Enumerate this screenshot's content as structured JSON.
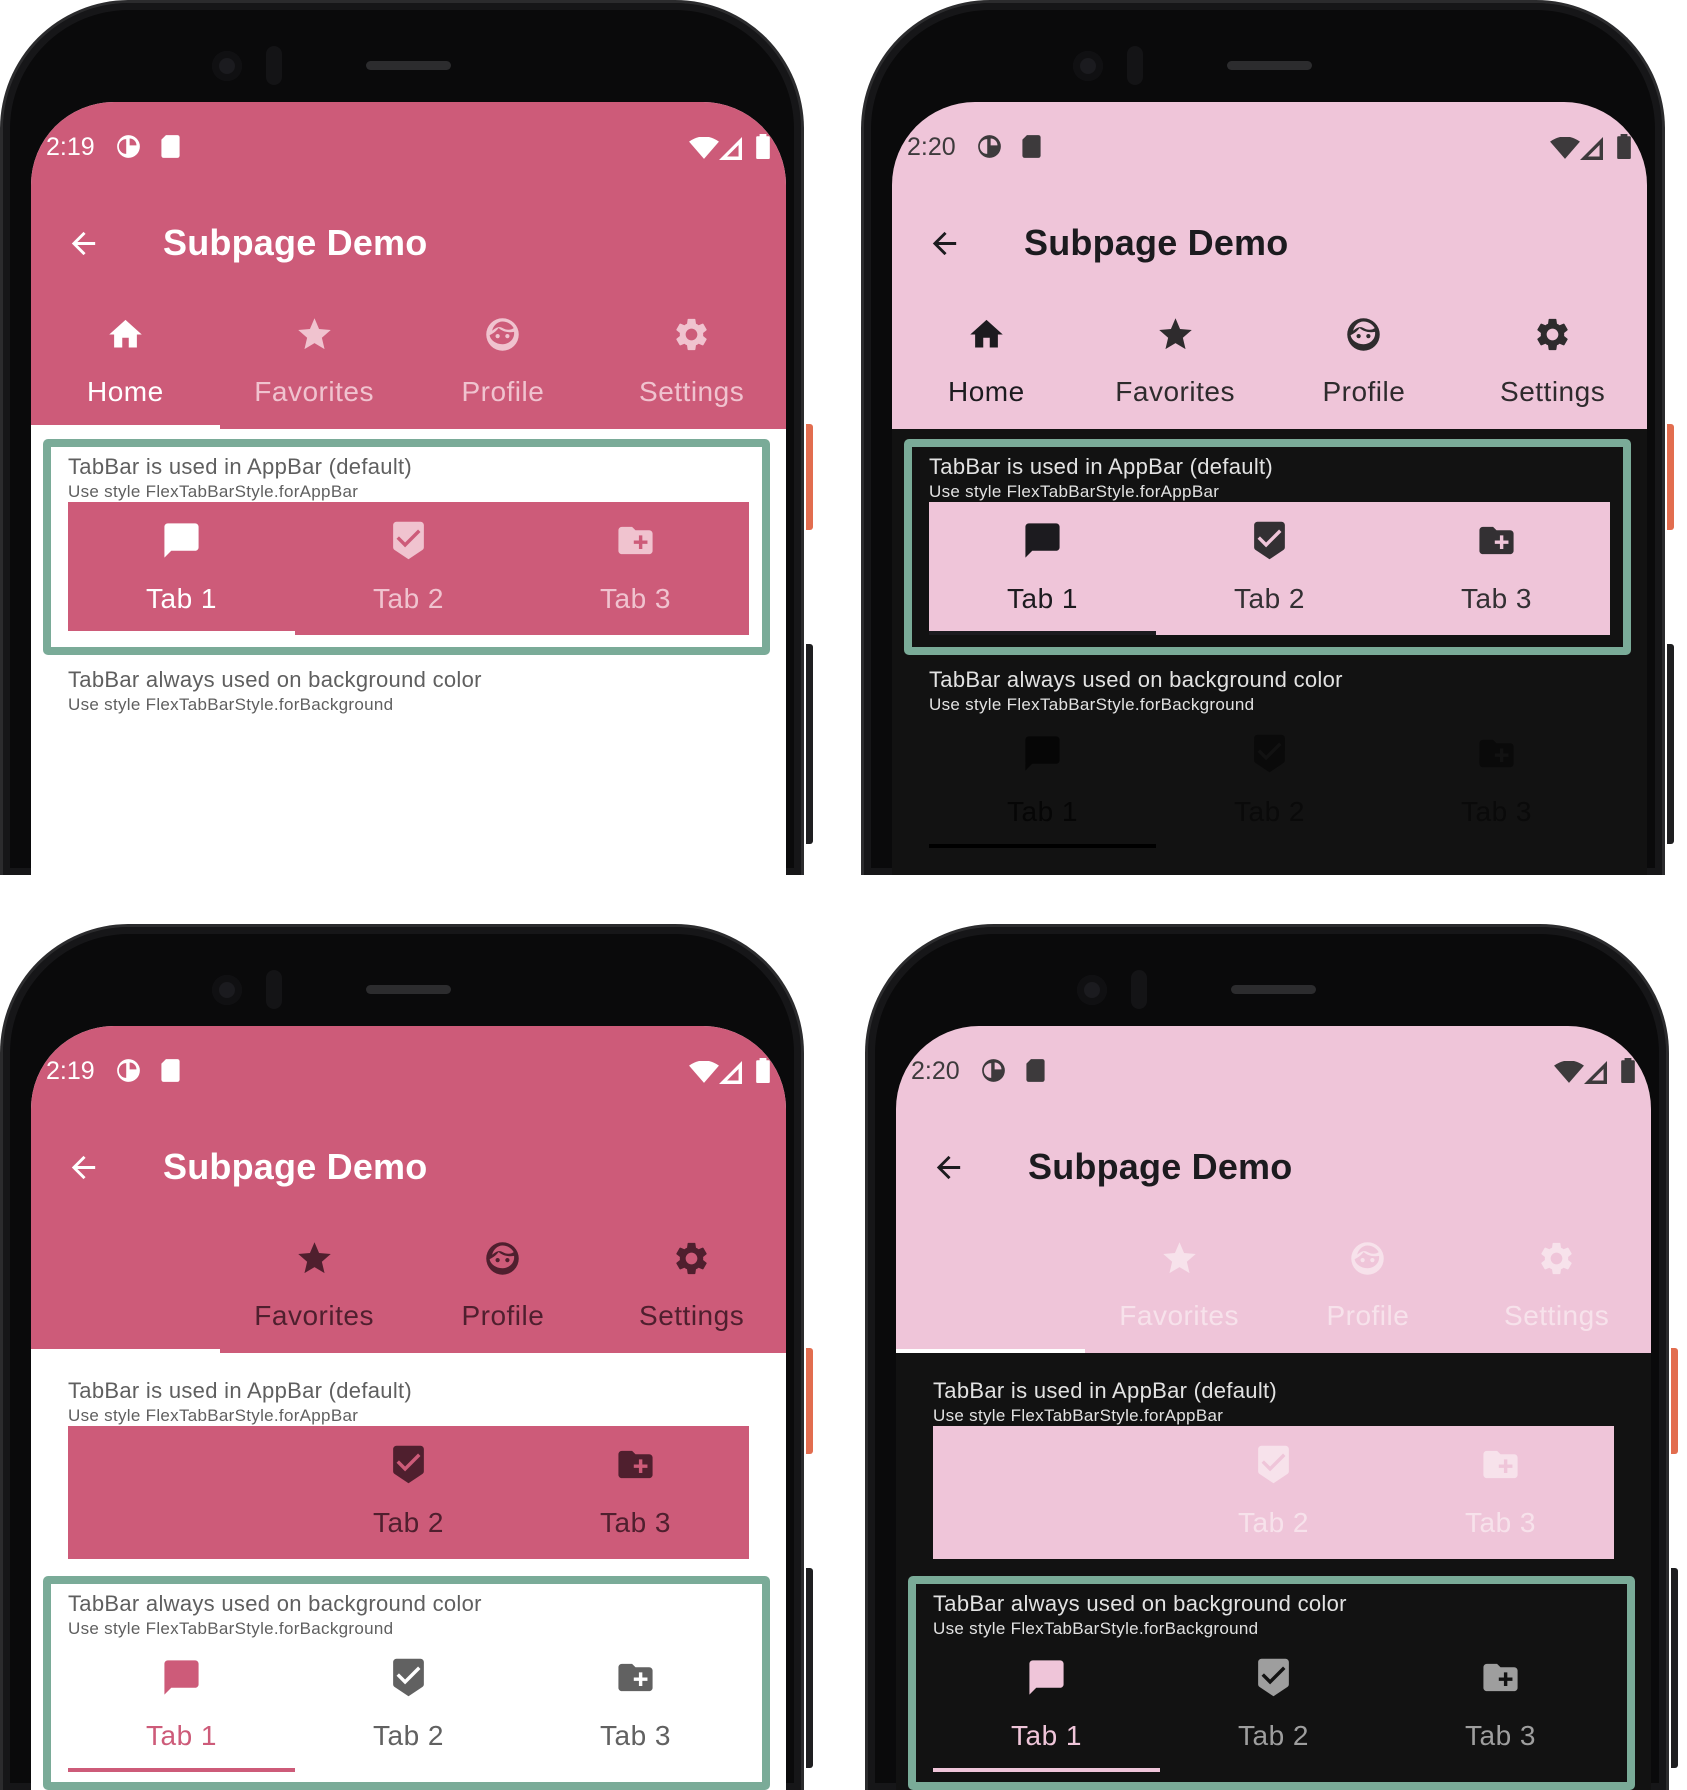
{
  "highlight_color": "#7aab98",
  "phones": [
    {
      "status_time": "2:19",
      "title": "Subpage Demo",
      "colors": {
        "appbar": "#cd5b79",
        "appbar_fg": "#ffffff",
        "status_fg": "#ffffff",
        "tab_selected": "#ffffff",
        "tab_unselected": "#f0c3cf",
        "indicator": "#ffffff",
        "content_bg": "#ffffff",
        "text": "#5f5f5f"
      },
      "appbar_tabs": {
        "selected_index": 0,
        "items": [
          {
            "label": "Home",
            "icon": "home-icon"
          },
          {
            "label": "Favorites",
            "icon": "star-icon"
          },
          {
            "label": "Profile",
            "icon": "face-icon"
          },
          {
            "label": "Settings",
            "icon": "settings-icon"
          }
        ]
      },
      "sections": [
        {
          "title": "TabBar is used in AppBar (default)",
          "subtitle": "Use style FlexTabBarStyle.forAppBar",
          "highlighted": true,
          "tabbar": {
            "bg": "#cd5b79",
            "selected": "#ffffff",
            "unselected": "#f0c3cf",
            "indicator": "#ffffff",
            "selected_index": 0,
            "items": [
              {
                "label": "Tab 1",
                "icon": "chat-icon"
              },
              {
                "label": "Tab 2",
                "icon": "beenhere-icon"
              },
              {
                "label": "Tab 3",
                "icon": "create-folder-icon"
              }
            ]
          }
        },
        {
          "title": "TabBar always used on background color",
          "subtitle": "Use style FlexTabBarStyle.forBackground",
          "highlighted": false,
          "tabbar": null
        }
      ]
    },
    {
      "status_time": "2:20",
      "title": "Subpage Demo",
      "colors": {
        "appbar": "#efc5d9",
        "appbar_fg": "#1c1b1f",
        "status_fg": "#3d3a3c",
        "tab_selected": "#1c1b1f",
        "tab_unselected": "#2e2b2d",
        "indicator": "#efc5d9",
        "content_bg": "#121212",
        "text": "#e2e2e2"
      },
      "appbar_tabs": {
        "selected_index": 0,
        "items": [
          {
            "label": "Home",
            "icon": "home-icon"
          },
          {
            "label": "Favorites",
            "icon": "star-icon"
          },
          {
            "label": "Profile",
            "icon": "face-icon"
          },
          {
            "label": "Settings",
            "icon": "settings-icon"
          }
        ]
      },
      "sections": [
        {
          "title": "TabBar is used in AppBar (default)",
          "subtitle": "Use style FlexTabBarStyle.forAppBar",
          "highlighted": true,
          "tabbar": {
            "bg": "#efc5d9",
            "selected": "#1c1b1f",
            "unselected": "#333033",
            "indicator": "#1c1b1f",
            "selected_index": 0,
            "items": [
              {
                "label": "Tab 1",
                "icon": "chat-icon"
              },
              {
                "label": "Tab 2",
                "icon": "beenhere-icon"
              },
              {
                "label": "Tab 3",
                "icon": "create-folder-icon"
              }
            ]
          }
        },
        {
          "title": "TabBar always used on background color",
          "subtitle": "Use style FlexTabBarStyle.forBackground",
          "highlighted": false,
          "tabbar": {
            "bg": "transparent",
            "selected": "#060606",
            "unselected": "#0a0a0a",
            "indicator": "#000000",
            "selected_index": 0,
            "items": [
              {
                "label": "Tab 1",
                "icon": "chat-icon"
              },
              {
                "label": "Tab 2",
                "icon": "beenhere-icon"
              },
              {
                "label": "Tab 3",
                "icon": "create-folder-icon"
              }
            ]
          }
        }
      ]
    },
    {
      "status_time": "2:19",
      "title": "Subpage Demo",
      "colors": {
        "appbar": "#cd5b79",
        "appbar_fg": "#ffffff",
        "status_fg": "#ffffff",
        "tab_selected": "#ffffff",
        "tab_unselected": "#4f1f2e",
        "indicator": "#ffffff",
        "content_bg": "#ffffff",
        "text": "#5f5f5f"
      },
      "appbar_tabs": {
        "selected_index": 0,
        "items": [
          null,
          {
            "label": "Favorites",
            "icon": "star-icon"
          },
          {
            "label": "Profile",
            "icon": "face-icon"
          },
          {
            "label": "Settings",
            "icon": "settings-icon"
          }
        ]
      },
      "sections": [
        {
          "title": "TabBar is used in AppBar (default)",
          "subtitle": "Use style FlexTabBarStyle.forAppBar",
          "highlighted": false,
          "tabbar": {
            "bg": "#cd5b79",
            "selected": "#ffffff",
            "unselected": "#4f1f2e",
            "indicator": null,
            "selected_index": 0,
            "items": [
              null,
              {
                "label": "Tab 2",
                "icon": "beenhere-icon"
              },
              {
                "label": "Tab 3",
                "icon": "create-folder-icon"
              }
            ]
          }
        },
        {
          "title": "TabBar always used on background color",
          "subtitle": "Use style FlexTabBarStyle.forBackground",
          "highlighted": true,
          "tabbar": {
            "bg": "#ffffff",
            "selected": "#cd5b79",
            "unselected": "#616161",
            "indicator": "#cd5b79",
            "selected_index": 0,
            "items": [
              {
                "label": "Tab 1",
                "icon": "chat-icon"
              },
              {
                "label": "Tab 2",
                "icon": "beenhere-icon"
              },
              {
                "label": "Tab 3",
                "icon": "create-folder-icon"
              }
            ]
          }
        }
      ]
    },
    {
      "status_time": "2:20",
      "title": "Subpage Demo",
      "colors": {
        "appbar": "#efc5d9",
        "appbar_fg": "#1c1b1f",
        "status_fg": "#3d3a3c",
        "tab_selected": "#1c1b1f",
        "tab_unselected": "#f7e2eb",
        "indicator": "#ffffff",
        "content_bg": "#121212",
        "text": "#e2e2e2"
      },
      "appbar_tabs": {
        "selected_index": 0,
        "items": [
          null,
          {
            "label": "Favorites",
            "icon": "star-icon"
          },
          {
            "label": "Profile",
            "icon": "face-icon"
          },
          {
            "label": "Settings",
            "icon": "settings-icon"
          }
        ]
      },
      "sections": [
        {
          "title": "TabBar is used in AppBar (default)",
          "subtitle": "Use style FlexTabBarStyle.forAppBar",
          "highlighted": false,
          "tabbar": {
            "bg": "#efc5d9",
            "selected": "#1c1b1f",
            "unselected": "#f7e2eb",
            "indicator": null,
            "selected_index": 0,
            "items": [
              null,
              {
                "label": "Tab 2",
                "icon": "beenhere-icon"
              },
              {
                "label": "Tab 3",
                "icon": "create-folder-icon"
              }
            ]
          }
        },
        {
          "title": "TabBar always used on background color",
          "subtitle": "Use style FlexTabBarStyle.forBackground",
          "highlighted": true,
          "tabbar": {
            "bg": "transparent",
            "selected": "#efc5d9",
            "unselected": "#9e9e9e",
            "indicator": "#efc5d9",
            "selected_index": 0,
            "items": [
              {
                "label": "Tab 1",
                "icon": "chat-icon"
              },
              {
                "label": "Tab 2",
                "icon": "beenhere-icon"
              },
              {
                "label": "Tab 3",
                "icon": "create-folder-icon"
              }
            ]
          }
        }
      ]
    }
  ]
}
